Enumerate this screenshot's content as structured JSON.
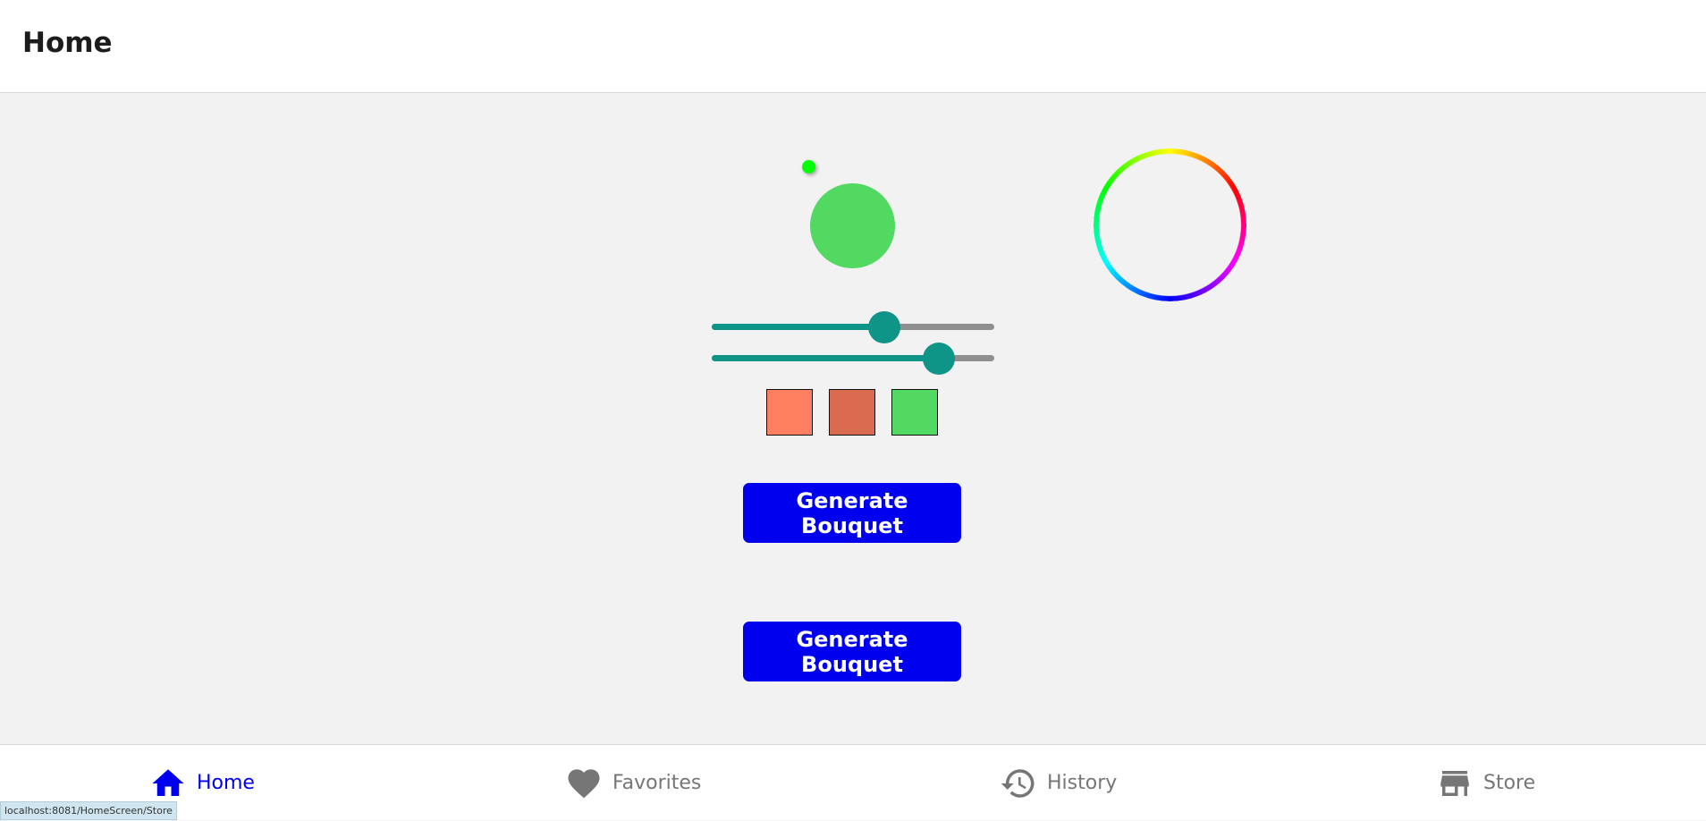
{
  "header": {
    "title": "Home"
  },
  "picker": {
    "selected_color": "#52d962",
    "dot_color": "#00ff00",
    "slider_color": "#0f9488",
    "rail_color": "#8f8f8f",
    "sliders": [
      {
        "name": "saturation",
        "value": 0.61
      },
      {
        "name": "brightness",
        "value": 0.805
      }
    ]
  },
  "swatches": [
    {
      "color": "#ff8060"
    },
    {
      "color": "#d96b4f"
    },
    {
      "color": "#52d962"
    }
  ],
  "buttons": {
    "generate_1": "Generate Bouquet",
    "generate_2": "Generate Bouquet",
    "color": "#0000ee"
  },
  "tabs": {
    "active_color": "#0000ee",
    "inactive_color": "#767676",
    "items": [
      {
        "label": "Home",
        "icon": "home-icon",
        "active": true
      },
      {
        "label": "Favorites",
        "icon": "heart-icon",
        "active": false
      },
      {
        "label": "History",
        "icon": "history-icon",
        "active": false
      },
      {
        "label": "Store",
        "icon": "store-icon",
        "active": false
      }
    ]
  },
  "status_bar": {
    "url": "localhost:8081/HomeScreen/Store"
  }
}
